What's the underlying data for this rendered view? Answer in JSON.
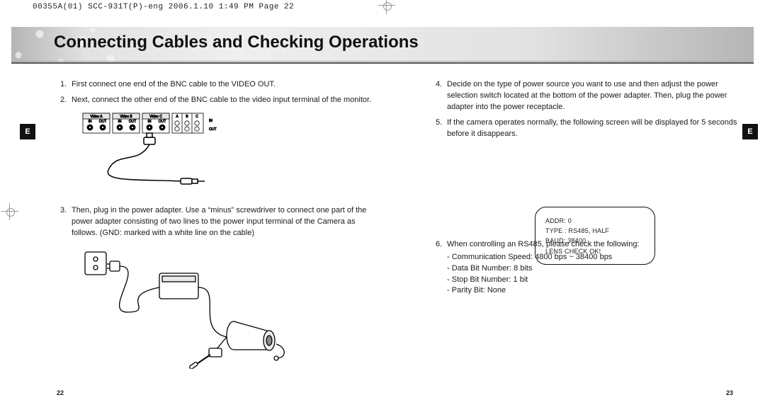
{
  "header": {
    "crop_label": "00355A(01) SCC-931T(P)-eng  2006.1.10  1:49 PM  Page 22",
    "title": "Connecting Cables and Checking Operations"
  },
  "side_tabs": {
    "left": "E",
    "right": "E"
  },
  "left_column": {
    "step1": {
      "num": "1.",
      "text": "First connect one end of the BNC cable to the VIDEO OUT."
    },
    "step2": {
      "num": "2.",
      "text": "Next, connect the other end of the BNC cable to the video input terminal of the monitor."
    },
    "panel": {
      "video_a": "Video A",
      "video_b": "Video B",
      "video_c": "Video C",
      "in": "IN",
      "out": "OUT",
      "abc_a": "A",
      "abc_b": "B",
      "abc_c": "C"
    },
    "step3": {
      "num": "3.",
      "text": "Then, plug in the power adapter. Use a “minus” screwdriver to connect one part of the power adapter consisting of two lines to the power input terminal of the Camera as follows. (GND: marked with a white line on the cable)"
    }
  },
  "right_column": {
    "step4": {
      "num": "4.",
      "text": "Decide on the type of power source you want to use and then adjust the power selection switch located at the bottom of the power adapter. Then, plug the power adapter into the power receptacle."
    },
    "step5": {
      "num": "5.",
      "text": "If the camera operates normally, the following screen will be displayed for 5 seconds before it disappears."
    },
    "screen": {
      "l1": "ADDR: 0",
      "l2": "TYPE : RS485, HALF",
      "l3": "BAUD: 38400",
      "l4": "LENS CHECK OK!"
    },
    "step6": {
      "num": "6.",
      "text": "When controlling an RS485, please check the following:",
      "b1": "Communication Speed: 4800 bps ~ 38400 bps",
      "b2": "Data Bit Number: 8 bits",
      "b3": "Stop Bit Number: 1 bit",
      "b4": "Parity Bit: None"
    }
  },
  "page_numbers": {
    "left": "22",
    "right": "23"
  }
}
